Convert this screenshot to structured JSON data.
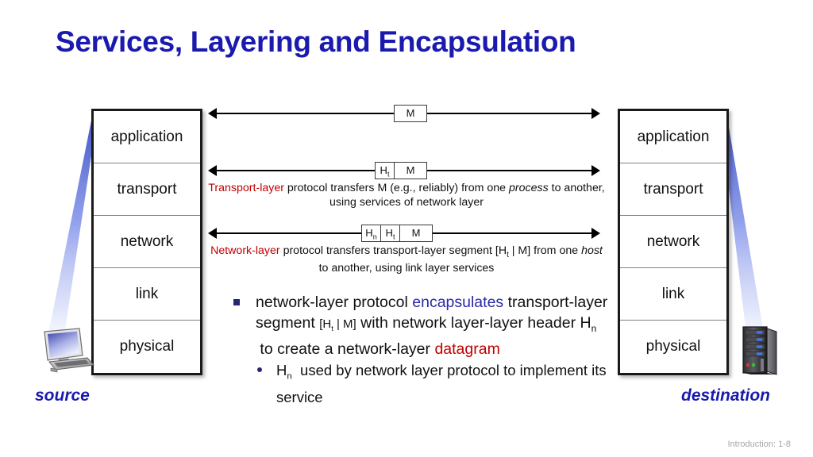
{
  "slide": {
    "title": "Services, Layering and Encapsulation",
    "footer": "Introduction: 1-8"
  },
  "colors": {
    "title_blue": "#1a1aaf",
    "highlight_red": "#c00000",
    "highlight_blue": "#2a2aa8",
    "bullet_navy": "#262673",
    "cone_blue": "#6b7fe0",
    "footer_gray": "#a6a6a6"
  },
  "stacks": {
    "source": {
      "endpoint_label": "source",
      "device_icon": "desktop-computer-icon",
      "layers": [
        "application",
        "transport",
        "network",
        "link",
        "physical"
      ]
    },
    "destination": {
      "endpoint_label": "destination",
      "device_icon": "server-tower-icon",
      "layers": [
        "application",
        "transport",
        "network",
        "link",
        "physical"
      ]
    }
  },
  "rows": [
    {
      "name": "application-row",
      "pdu": [
        "M"
      ],
      "caption_html": ""
    },
    {
      "name": "transport-row",
      "pdu": [
        "H<sub>t</sub>",
        "M"
      ],
      "caption_html": "<span class=\"hl-red\">Transport-layer</span> protocol transfers M (e.g., reliably) from one <em>process</em> to another, using services of network layer"
    },
    {
      "name": "network-row",
      "pdu": [
        "H<sub>n</sub>",
        "H<sub>t</sub>",
        "M"
      ],
      "caption_html": "<span class=\"hl-red\">Network-layer</span> protocol transfers transport-layer segment [H<sub>t</sub> | M] from one <em>host</em> to another, using link layer services"
    }
  ],
  "bullets": {
    "main_html": "network-layer protocol <span class=\"hl-blue\">encapsulates</span> transport-layer segment <span class=\"small-pdu\">[H<sub>t</sub> | M]</span> with network layer-layer header H<sub>n</sub> &nbsp;to create a network-layer <span class=\"hl-red\">datagram</span>",
    "sub_html": "H<sub>n</sub> &nbsp;used by network layer protocol to implement its service"
  }
}
